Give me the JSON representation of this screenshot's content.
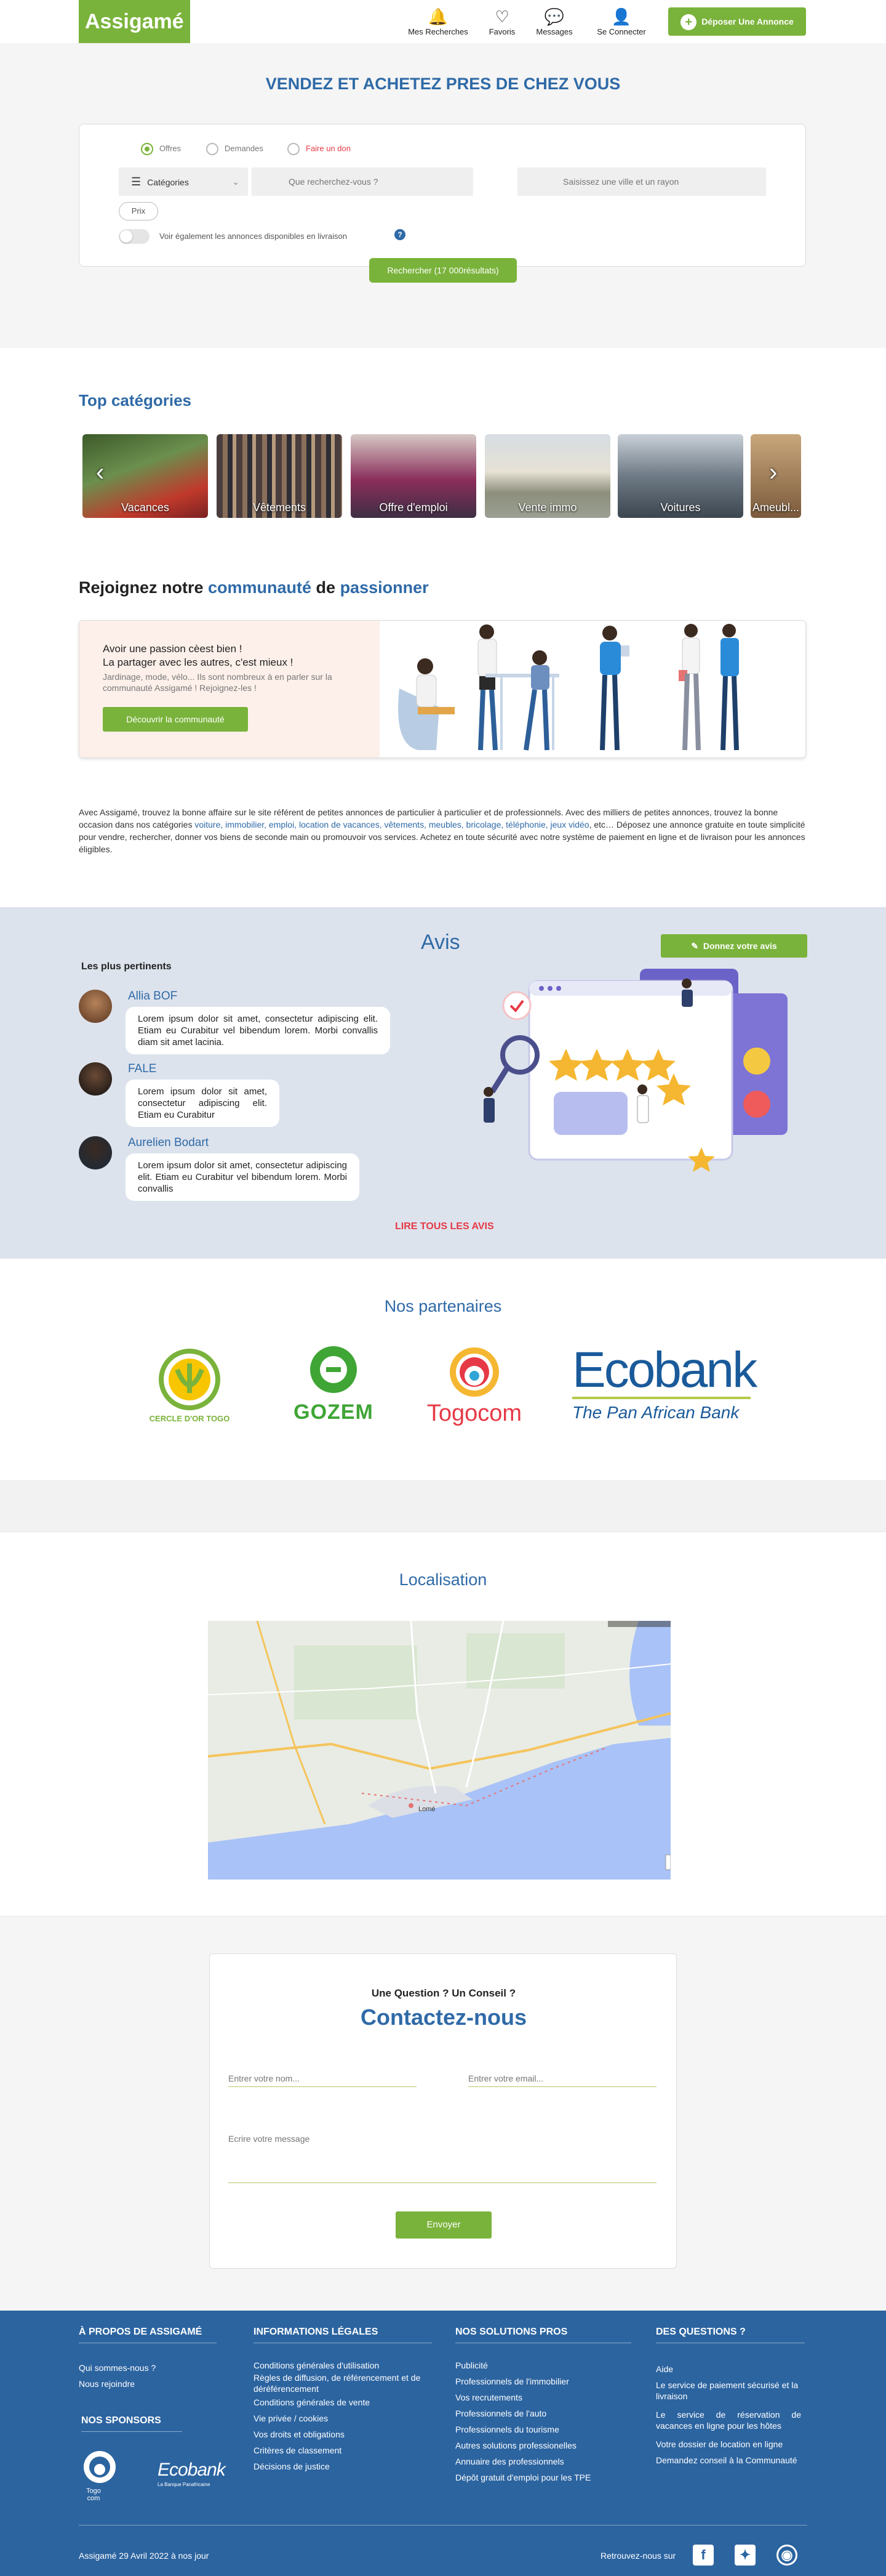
{
  "header": {
    "logo": "Assigamé",
    "nav": [
      {
        "label": "Mes Recherches",
        "icon": "bell-icon"
      },
      {
        "label": "Favoris",
        "icon": "heart-icon"
      },
      {
        "label": "Messages",
        "icon": "chat-icon"
      },
      {
        "label": "Se Connecter",
        "icon": "user-icon"
      }
    ],
    "deposit_label": "Déposer Une Annonce"
  },
  "search": {
    "title": "VENDEZ ET ACHETEZ PRES DE CHEZ VOUS",
    "radios": [
      {
        "label": "Offres",
        "selected": true
      },
      {
        "label": "Demandes",
        "selected": false
      },
      {
        "label": "Faire un don",
        "selected": false
      }
    ],
    "category_label": "Catégories",
    "query_placeholder": "Que recherchez-vous ?",
    "city_placeholder": "Saisissez une ville et un rayon",
    "price_label": "Prix",
    "toggle_label": "Voir également les annonces disponibles en livraison",
    "help": "?",
    "button_label": "Rechercher (17 000résultats)"
  },
  "categories": {
    "title": "Top catégories",
    "items": [
      "Vacances",
      "Vêtements",
      "Offre d'emploi",
      "Vente immo",
      "Voitures",
      "Ameubl..."
    ]
  },
  "community": {
    "title_a": "Rejoignez notre ",
    "title_b": "communauté",
    "title_c": " de ",
    "title_d": "passionner",
    "line1": "Avoir une passion cèest bien !",
    "line2": "La partager avec les autres, c'est mieux !",
    "line3": "Jardinage, mode, vélo... Ils sont nombreux à en parler sur la communauté Assigamé ! Rejoignez-les !",
    "button": "Découvrir la communauté"
  },
  "about": {
    "p1": "Avec Assigamé, trouvez la bonne affaire sur le site référent de petites annonces de particulier à particulier et de professionnels. Avec des milliers de petites annonces, trouvez la bonne occasion dans nos catégories ",
    "links": "voiture, immobilier, emploi, location de vacances, vêtements, meubles, bricolage, téléphonie, jeux vidéo",
    "p2": ", etc… Déposez une annonce gratuite en toute simplicité pour vendre, rechercher, donner vos biens de seconde main ou promouvoir vos services. Achetez en toute sécurité avec notre système de paiement en ligne et de livraison pour les annonces éligibles."
  },
  "avis": {
    "title": "Avis",
    "button": "Donnez votre avis",
    "subtitle": "Les plus pertinents",
    "reviews": [
      {
        "name": "Allia BOF",
        "text": "Lorem ipsum dolor sit amet, consectetur adipiscing elit. Etiam eu Curabitur vel bibendum lorem. Morbi convallis diam sit amet lacinia."
      },
      {
        "name": "FALE",
        "text": "Lorem ipsum dolor sit amet, consectetur adipiscing elit. Etiam eu Curabitur"
      },
      {
        "name": "Aurelien Bodart",
        "text": "Lorem ipsum dolor sit amet, consectetur adipiscing elit. Etiam eu Curabitur vel bibendum lorem. Morbi convallis"
      }
    ],
    "read_all": "LIRE TOUS LES AVIS"
  },
  "partners": {
    "title": "Nos partenaires",
    "items": [
      {
        "name": "CERCLE D'OR TOGO"
      },
      {
        "name": "GOZEM"
      },
      {
        "name": "Togocom"
      },
      {
        "name": "Ecobank",
        "tagline": "The Pan African Bank"
      }
    ]
  },
  "map": {
    "title": "Localisation",
    "city": "Lomé"
  },
  "contact": {
    "subtitle": "Une Question ? Un Conseil ?",
    "title": "Contactez-nous",
    "name_placeholder": "Entrer votre nom...",
    "email_placeholder": "Entrer votre email...",
    "message_placeholder": "Ecrire votre message",
    "button": "Envoyer"
  },
  "footer": {
    "about": {
      "heading": "À PROPOS DE ASSIGAMÉ",
      "links": [
        "Qui sommes-nous ?",
        "Nous rejoindre"
      ]
    },
    "sponsors": {
      "heading": "NOS SPONSORS",
      "items": [
        "Togo com",
        "Ecobank"
      ],
      "ecobank_tagline": "La Banque Panafricaine"
    },
    "legal": {
      "heading": "INFORMATIONS LÉGALES",
      "links": [
        "Conditions générales d'utilisation",
        "Règles de diffusion, de référencement et de déréférencement",
        "Conditions générales de vente",
        "Vie privée / cookies",
        "Vos droits et obligations",
        "Critères de classement",
        "Décisions de justice"
      ]
    },
    "pros": {
      "heading": "NOS SOLUTIONS PROS",
      "links": [
        "Publicité",
        "Professionnels de l'immobilier",
        "Vos recrutements",
        "Professionnels de l'auto",
        "Professionnels du tourisme",
        "Autres solutions professionelles",
        "Annuaire des professionnels",
        "Dépôt gratuit d'emploi pour les TPE"
      ]
    },
    "questions": {
      "heading": "DES QUESTIONS ?",
      "links": [
        "Aide",
        "Le service de paiement sécurisé et la livraison",
        "Le service de réservation de vacances en ligne pour les hôtes",
        "Votre dossier de location en ligne",
        "Demandez conseil à la Communauté"
      ]
    },
    "copyright": "Assigamé 29 Avril 2022 à nos jour",
    "social_label": "Retrouvez-nous sur",
    "social_icons": [
      "facebook-icon",
      "twitter-icon",
      "instagram-icon"
    ]
  },
  "colors": {
    "green": "#7ab33b",
    "blue": "#2f6aa7",
    "footer": "#2c64a0",
    "red": "#e63946"
  }
}
